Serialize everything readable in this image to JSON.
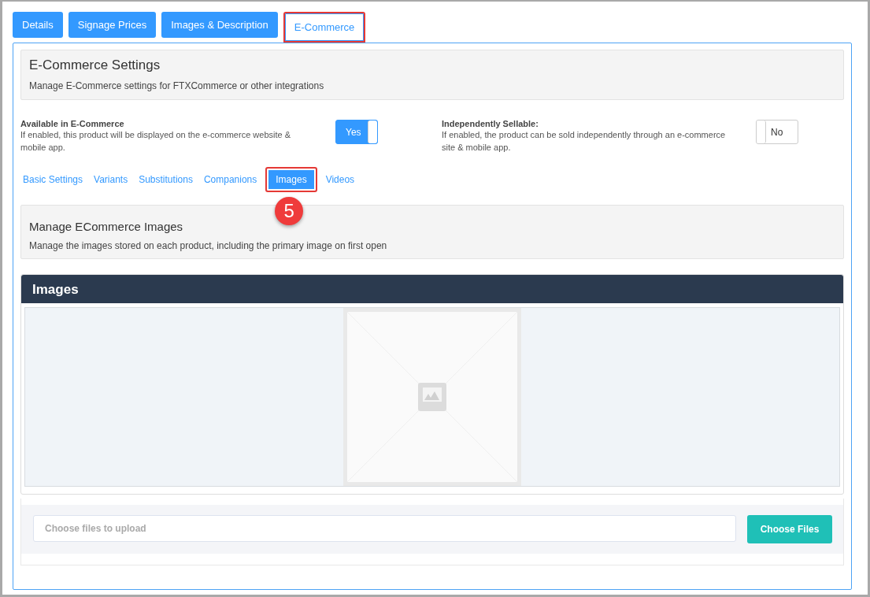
{
  "tabs": [
    {
      "label": "Details",
      "selected": false,
      "highlighted": false
    },
    {
      "label": "Signage Prices",
      "selected": false,
      "highlighted": false
    },
    {
      "label": "Images & Description",
      "selected": false,
      "highlighted": false
    },
    {
      "label": "E-Commerce",
      "selected": true,
      "highlighted": true
    }
  ],
  "settings_header": {
    "title": "E-Commerce Settings",
    "description": "Manage E-Commerce settings for FTXCommerce or other integrations"
  },
  "toggles": [
    {
      "label": "Available in E-Commerce",
      "description": "If enabled, this product will be displayed on the e-commerce website & mobile app.",
      "on": true,
      "value": "Yes"
    },
    {
      "label": "Independently Sellable:",
      "description": "If enabled, the product can be sold independently through an e-commerce site & mobile app.",
      "on": false,
      "value": "No"
    }
  ],
  "subtabs": [
    {
      "label": "Basic Settings",
      "selected": false,
      "highlighted": false
    },
    {
      "label": "Variants",
      "selected": false,
      "highlighted": false
    },
    {
      "label": "Substitutions",
      "selected": false,
      "highlighted": false
    },
    {
      "label": "Companions",
      "selected": false,
      "highlighted": false
    },
    {
      "label": "Images",
      "selected": true,
      "highlighted": true,
      "callout": "5"
    },
    {
      "label": "Videos",
      "selected": false,
      "highlighted": false
    }
  ],
  "images_header": {
    "title": "Manage ECommerce Images",
    "description": "Manage the images stored on each product, including the primary image on first open"
  },
  "images_panel": {
    "title": "Images"
  },
  "upload": {
    "placeholder": "Choose files to upload",
    "button": "Choose Files"
  }
}
